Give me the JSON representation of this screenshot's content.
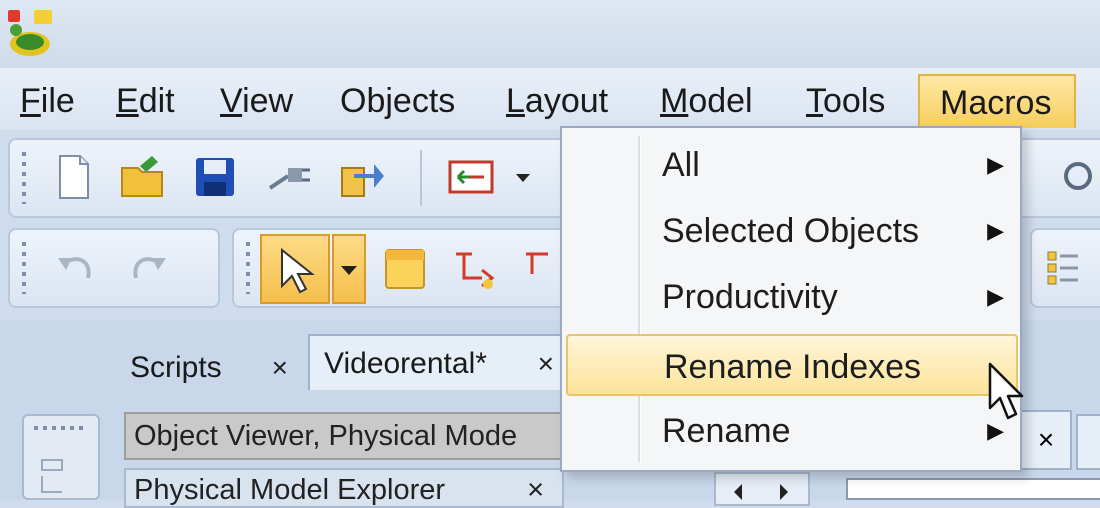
{
  "menubar": {
    "items": [
      {
        "label_u": "F",
        "label_rest": "ile"
      },
      {
        "label_u": "E",
        "label_rest": "dit"
      },
      {
        "label_u": "V",
        "label_rest": "iew"
      },
      {
        "label_u": "",
        "label_rest": "Objects"
      },
      {
        "label_u": "L",
        "label_rest": "ayout"
      },
      {
        "label_u": "M",
        "label_rest": "odel"
      },
      {
        "label_u": "T",
        "label_rest": "ools"
      },
      {
        "label_u": "",
        "label_rest": "Macros"
      }
    ]
  },
  "macros_menu": {
    "items": [
      {
        "label": "All"
      },
      {
        "label": "Selected Objects"
      },
      {
        "label": "Productivity"
      },
      {
        "label": "Rename Indexes"
      },
      {
        "label": "Rename"
      }
    ],
    "highlighted_index": 3
  },
  "tabs": [
    {
      "label": "Scripts",
      "close": "×"
    },
    {
      "label": "Videorental*",
      "close": "×"
    }
  ],
  "panels": {
    "object_viewer": "Object Viewer, Physical Mode",
    "explorer": "Physical Model Explorer",
    "explorer_close": "×",
    "right_tab_close": "×"
  },
  "icons": [
    "app-turtle-icon",
    "new-file-icon",
    "open-folder-icon",
    "save-icon",
    "connect-icon",
    "export-icon",
    "switch-icon",
    "chevron-down-icon",
    "undo-icon",
    "redo-icon",
    "pointer-icon",
    "table-icon",
    "relation-icon",
    "submenu-arrow-icon",
    "mouse-cursor-icon"
  ]
}
